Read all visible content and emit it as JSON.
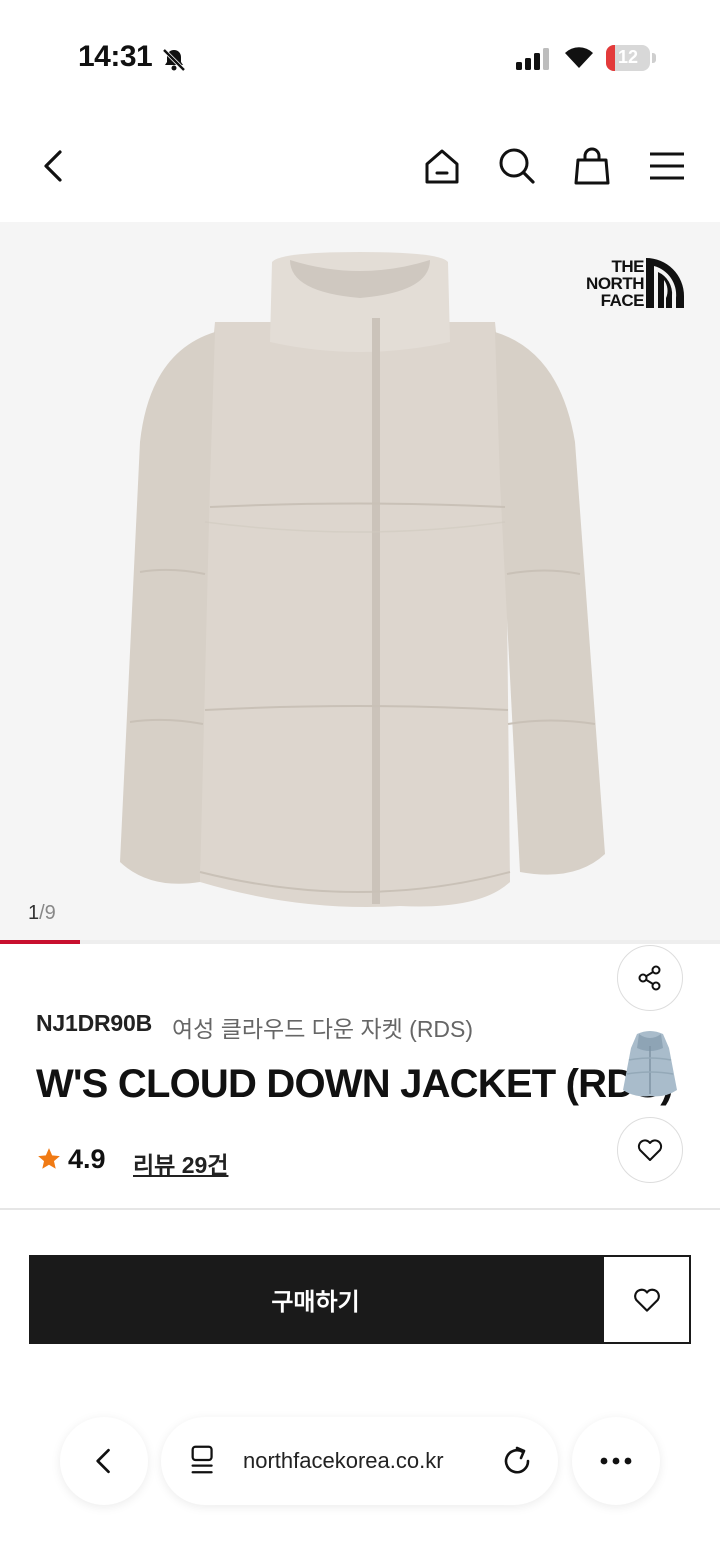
{
  "status_bar": {
    "time": "14:31",
    "battery": "12",
    "battery_color": "#e33a3a",
    "icons": [
      "bell-slash-icon",
      "signal-icon",
      "wifi-icon",
      "battery-icon"
    ]
  },
  "top_nav": {
    "icons": [
      "back-chevron-icon",
      "home-icon",
      "search-icon",
      "shopping-bag-icon",
      "menu-icon"
    ]
  },
  "gallery": {
    "current": "1",
    "total": "/9",
    "progress": 0.111,
    "brand_logo": [
      "THE",
      "NORTH",
      "FACE"
    ],
    "background": "#f5f5f5"
  },
  "product": {
    "code": "NJ1DR90B",
    "name_ko": "여성 클라우드 다운 자켓 (RDS)",
    "title": "W'S CLOUD DOWN JACKET (RDS)",
    "rating": "4.9",
    "reviews": "리뷰 29건",
    "star_color": "#f07a14"
  },
  "actions": {
    "share_icon": "share-icon",
    "wishlist_icon": "heart-icon",
    "buy_label": "구매하기"
  },
  "browser": {
    "url": "northfacekorea.co.kr",
    "icons": [
      "back-chevron-icon",
      "tabs-icon",
      "reload-icon",
      "more-icon"
    ]
  },
  "accent_color": "#c8102e"
}
